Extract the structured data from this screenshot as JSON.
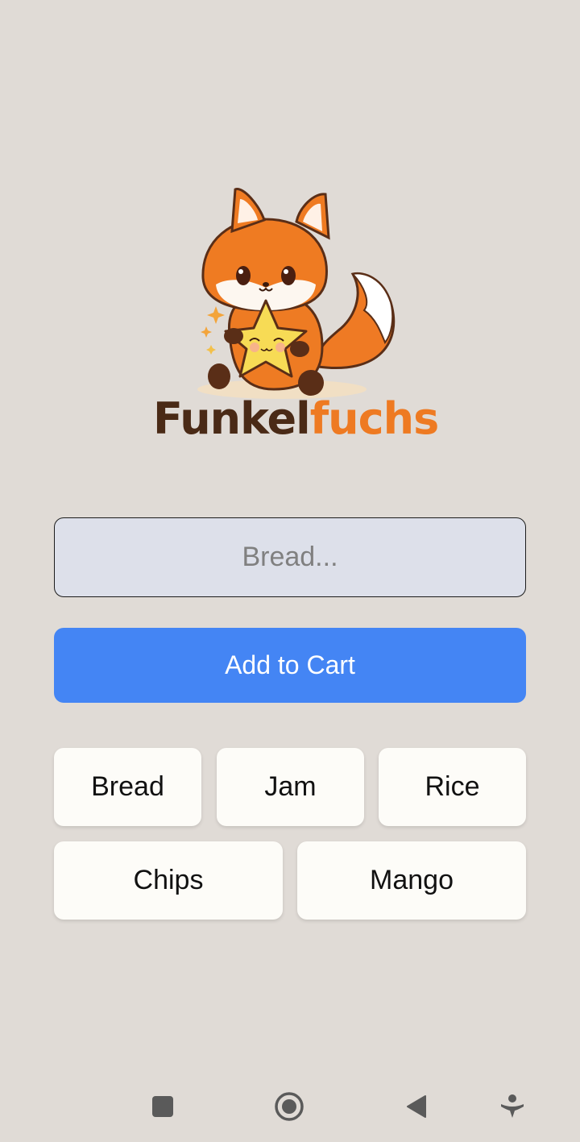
{
  "brand": {
    "name_part1": "Funkel",
    "name_part2": "fuchs",
    "logo_icon": "fox-holding-star-icon",
    "colors": {
      "dark_brown": "#4a2a16",
      "orange": "#ee7a22"
    }
  },
  "form": {
    "item_placeholder": "Bread...",
    "item_value": "",
    "add_button_label": "Add to Cart",
    "add_button_color": "#4485f4"
  },
  "quick_items": [
    {
      "label": "Bread"
    },
    {
      "label": "Jam"
    },
    {
      "label": "Rice"
    },
    {
      "label": "Chips"
    },
    {
      "label": "Mango"
    }
  ],
  "navbar": {
    "buttons": [
      {
        "icon": "square-icon"
      },
      {
        "icon": "home-circle-icon"
      },
      {
        "icon": "back-triangle-icon"
      },
      {
        "icon": "accessibility-icon"
      }
    ]
  }
}
